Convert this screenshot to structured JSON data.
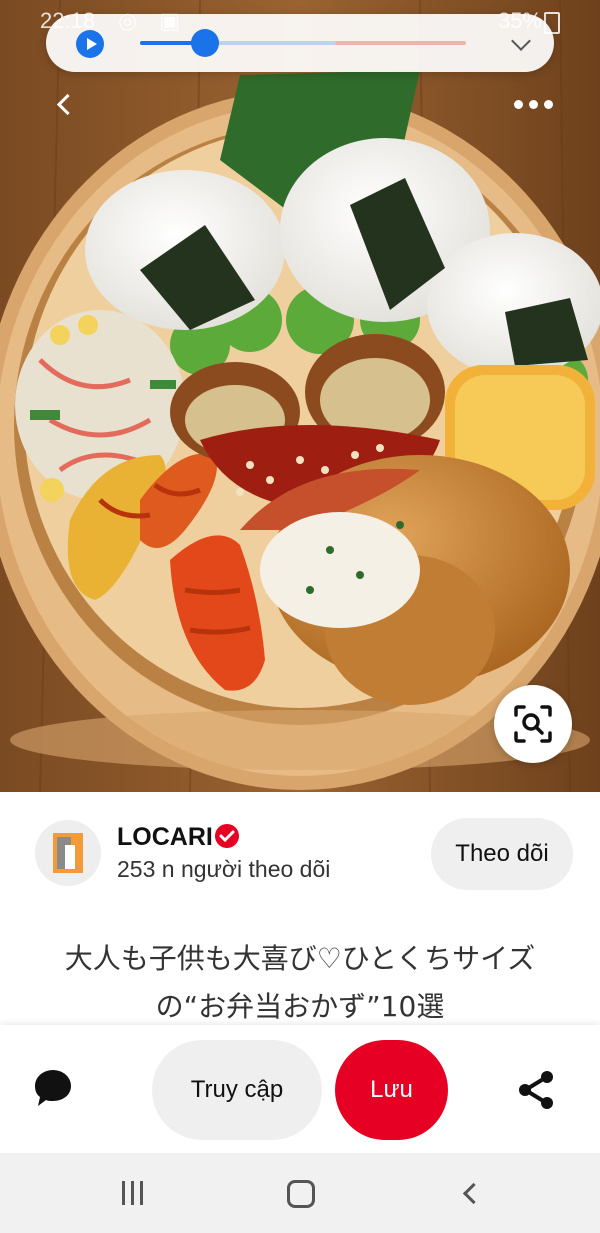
{
  "status_bar": {
    "time": "22:18",
    "battery": "35%"
  },
  "media_player": {
    "progress_fraction": 0.2,
    "buffered_fraction": 0.6
  },
  "pin_image": {
    "description_icon": "bento-photo"
  },
  "creator": {
    "name": "LOCARI",
    "followers": "253 n người theo dõi",
    "follow_label": "Theo dõi",
    "verified": true
  },
  "pin": {
    "title": "大人も子供も大喜び♡ひとくちサイズの“お弁当おかず”10選"
  },
  "actions": {
    "visit_label": "Truy cập",
    "save_label": "Lưu"
  },
  "colors": {
    "save_red": "#e60023",
    "accent_blue": "#1a73e8"
  }
}
